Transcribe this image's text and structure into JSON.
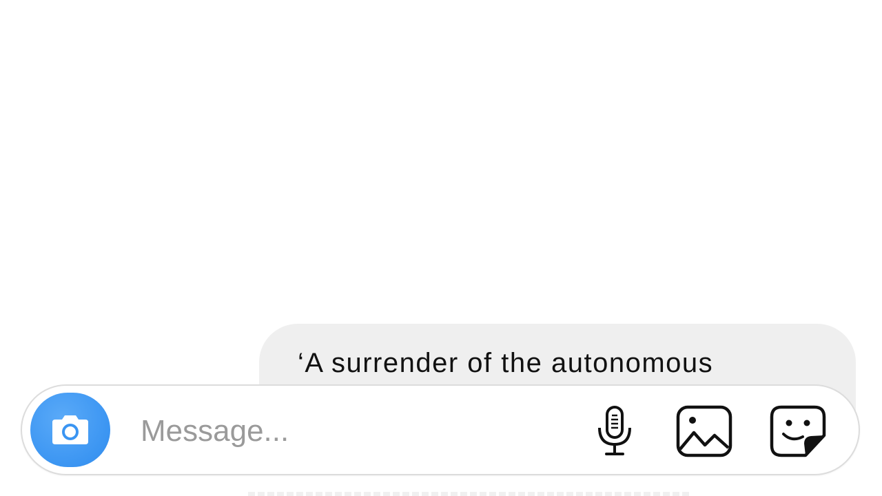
{
  "thread": {
    "messages": [
      {
        "text": "‘A surrender of the autonomous"
      }
    ]
  },
  "composer": {
    "placeholder": "Message...",
    "value": "",
    "camera_icon": "camera-icon",
    "mic_icon": "microphone-icon",
    "gallery_icon": "gallery-icon",
    "sticker_icon": "sticker-icon"
  },
  "colors": {
    "accent": "#3b95f2",
    "bubble": "#efefef",
    "placeholder": "#9a9a9a"
  }
}
